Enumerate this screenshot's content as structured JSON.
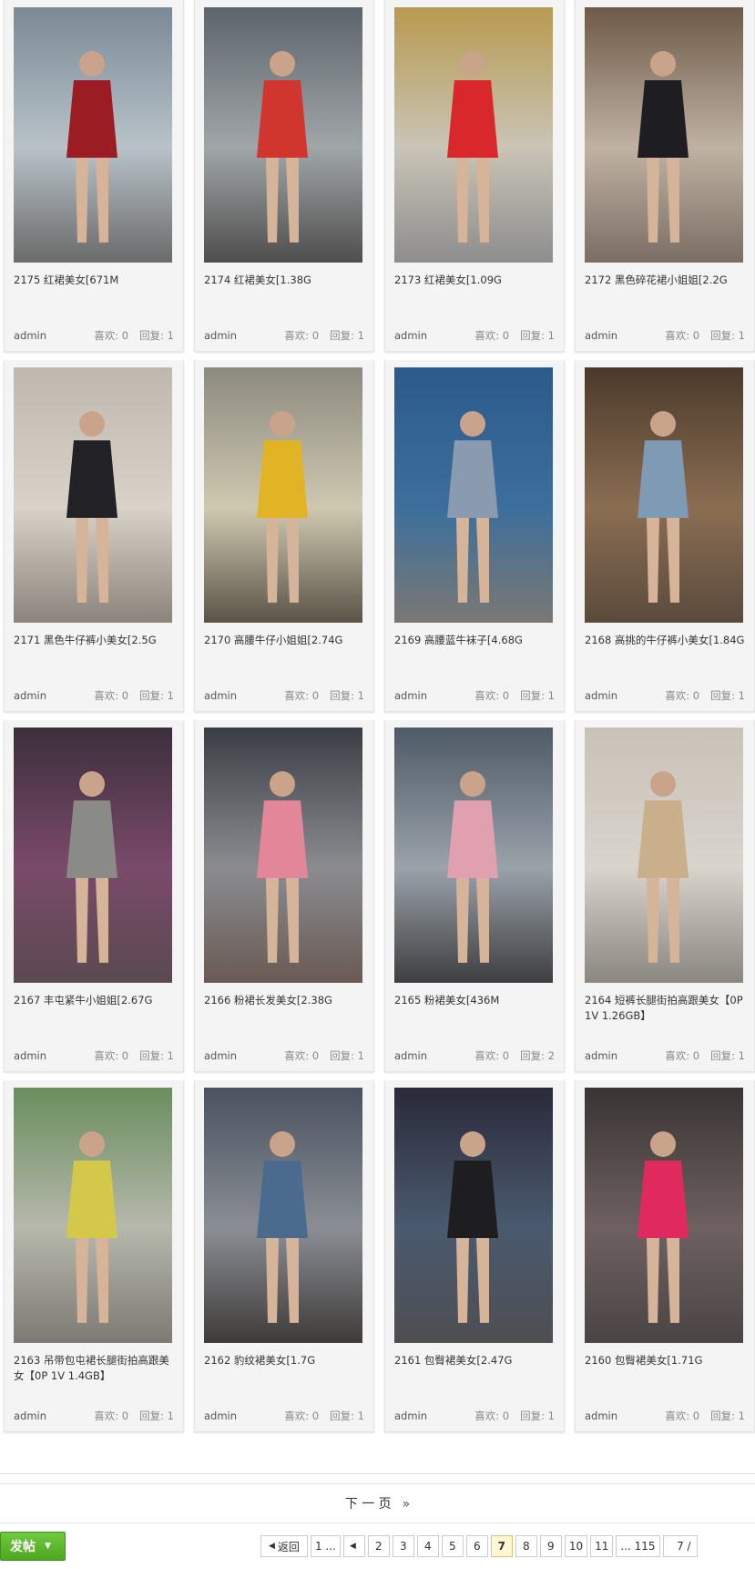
{
  "threads": [
    {
      "title": "2175 红裙美女[671M",
      "author": "admin",
      "likes": "喜欢: 0",
      "replies": "回复: 1"
    },
    {
      "title": "2174 红裙美女[1.38G",
      "author": "admin",
      "likes": "喜欢: 0",
      "replies": "回复: 1"
    },
    {
      "title": "2173 红裙美女[1.09G",
      "author": "admin",
      "likes": "喜欢: 0",
      "replies": "回复: 1"
    },
    {
      "title": "2172 黑色碎花裙小姐姐[2.2G",
      "author": "admin",
      "likes": "喜欢: 0",
      "replies": "回复: 1"
    },
    {
      "title": "2171 黑色牛仔裤小美女[2.5G",
      "author": "admin",
      "likes": "喜欢: 0",
      "replies": "回复: 1"
    },
    {
      "title": "2170 高腰牛仔小姐姐[2.74G",
      "author": "admin",
      "likes": "喜欢: 0",
      "replies": "回复: 1"
    },
    {
      "title": "2169 高腰蓝牛袜子[4.68G",
      "author": "admin",
      "likes": "喜欢: 0",
      "replies": "回复: 1"
    },
    {
      "title": "2168 高挑的牛仔裤小美女[1.84G",
      "author": "admin",
      "likes": "喜欢: 0",
      "replies": "回复: 1"
    },
    {
      "title": "2167 丰屯紧牛小姐姐[2.67G",
      "author": "admin",
      "likes": "喜欢: 0",
      "replies": "回复: 1"
    },
    {
      "title": "2166 粉裙长发美女[2.38G",
      "author": "admin",
      "likes": "喜欢: 0",
      "replies": "回复: 1"
    },
    {
      "title": "2165 粉裙美女[436M",
      "author": "admin",
      "likes": "喜欢: 0",
      "replies": "回复: 2"
    },
    {
      "title": "2164 短裤长腿街拍高跟美女【0P 1V 1.26GB】",
      "author": "admin",
      "likes": "喜欢: 0",
      "replies": "回复: 1"
    },
    {
      "title": "2163 吊带包屯裙长腿街拍高跟美女【0P 1V 1.4GB】",
      "author": "admin",
      "likes": "喜欢: 0",
      "replies": "回复: 1"
    },
    {
      "title": "2162 豹纹裙美女[1.7G",
      "author": "admin",
      "likes": "喜欢: 0",
      "replies": "回复: 1"
    },
    {
      "title": "2161 包臀裙美女[2.47G",
      "author": "admin",
      "likes": "喜欢: 0",
      "replies": "回复: 1"
    },
    {
      "title": "2160 包臀裙美女[1.71G",
      "author": "admin",
      "likes": "喜欢: 0",
      "replies": "回复: 1"
    }
  ],
  "thumb_colors": [
    {
      "top": "#7a8a96",
      "mid": "#b8c2c8",
      "bottom": "#6a6a6a",
      "figure": "#9c1c24"
    },
    {
      "top": "#5d646b",
      "mid": "#a0a6a8",
      "bottom": "#4e4e4c",
      "figure": "#d0352e"
    },
    {
      "top": "#b89a50",
      "mid": "#c9c4b6",
      "bottom": "#8d8d8d",
      "figure": "#d8282c"
    },
    {
      "top": "#6e5a48",
      "mid": "#bfb2a2",
      "bottom": "#7a6e64",
      "figure": "#1e1e22"
    },
    {
      "top": "#bfb8ae",
      "mid": "#d9d2c8",
      "bottom": "#8a847c",
      "figure": "#222226"
    },
    {
      "top": "#8c8a80",
      "mid": "#cfc8b0",
      "bottom": "#5a5448",
      "figure": "#e1b426"
    },
    {
      "top": "#2c5a8a",
      "mid": "#3c6f9c",
      "bottom": "#7b7874",
      "figure": "#8a9bb0"
    },
    {
      "top": "#4a3a2a",
      "mid": "#8a6e52",
      "bottom": "#5a4a3c",
      "figure": "#7f9ab4"
    },
    {
      "top": "#3c2f3c",
      "mid": "#7a4a6a",
      "bottom": "#5a4a50",
      "figure": "#8a8a86"
    },
    {
      "top": "#3a3e44",
      "mid": "#8a8c90",
      "bottom": "#6a5a54",
      "figure": "#e4869a"
    },
    {
      "top": "#4e5a66",
      "mid": "#9aa2aa",
      "bottom": "#3e3e40",
      "figure": "#e0a0b0"
    },
    {
      "top": "#c8c2b8",
      "mid": "#d9d4cc",
      "bottom": "#8a8680",
      "figure": "#c9b08a"
    },
    {
      "top": "#6a8e5e",
      "mid": "#b6b8ac",
      "bottom": "#7c7a74",
      "figure": "#d4c84a"
    },
    {
      "top": "#4a5260",
      "mid": "#8a8e94",
      "bottom": "#3e3a38",
      "figure": "#4a6a8e"
    },
    {
      "top": "#2a2a3a",
      "mid": "#4a5a6e",
      "bottom": "#4e4e52",
      "figure": "#1e1e20"
    },
    {
      "top": "#3a3434",
      "mid": "#6e6060",
      "bottom": "#4a4444",
      "figure": "#e02a5e"
    }
  ],
  "pagination": {
    "next_label": "下 一 页",
    "next_arrow": "»",
    "post_button": "发帖",
    "back_label": "返回",
    "first": "1 ...",
    "pages": [
      "2",
      "3",
      "4",
      "5",
      "6",
      "7",
      "8",
      "9",
      "10",
      "11"
    ],
    "current": "7",
    "last": "... 115",
    "jump_value": "7",
    "jump_suffix": "/"
  }
}
